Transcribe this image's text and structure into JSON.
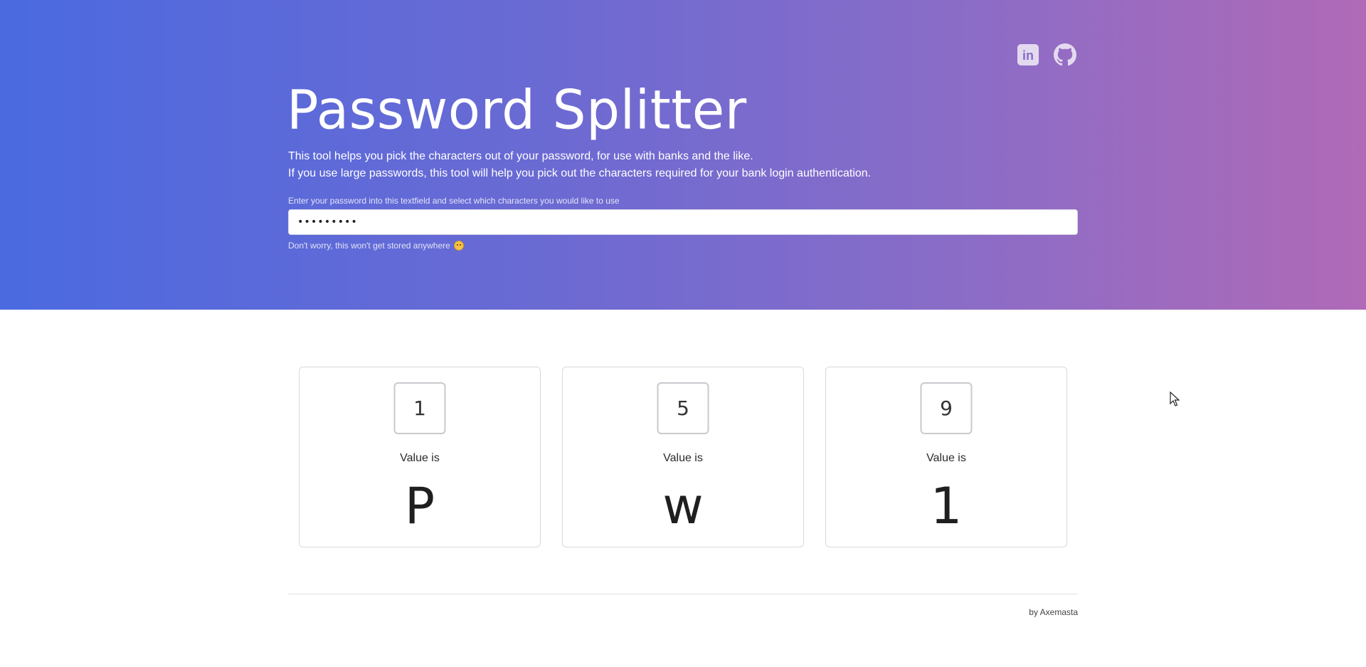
{
  "header": {
    "title": "Password Splitter",
    "description_line1": "This tool helps you pick the characters out of your password, for use with banks and the like.",
    "description_line2": "If you use large passwords, this tool will help you pick out the characters required for your bank login authentication.",
    "input_label": "Enter your password into this textfield and select which characters you would like to use",
    "password_value": "Password1",
    "helper_text": "Don't worry, this won't get stored anywhere",
    "social": [
      {
        "name": "linkedin-icon",
        "label": "in"
      },
      {
        "name": "github-icon"
      }
    ]
  },
  "cards": [
    {
      "position": "1",
      "value_label": "Value is",
      "value": "P"
    },
    {
      "position": "5",
      "value_label": "Value is",
      "value": "w"
    },
    {
      "position": "9",
      "value_label": "Value is",
      "value": "1"
    }
  ],
  "footer": {
    "credit": "by Axemasta"
  },
  "colors": {
    "gradient_start": "#4b6ae0",
    "gradient_end": "#b06ab7"
  }
}
